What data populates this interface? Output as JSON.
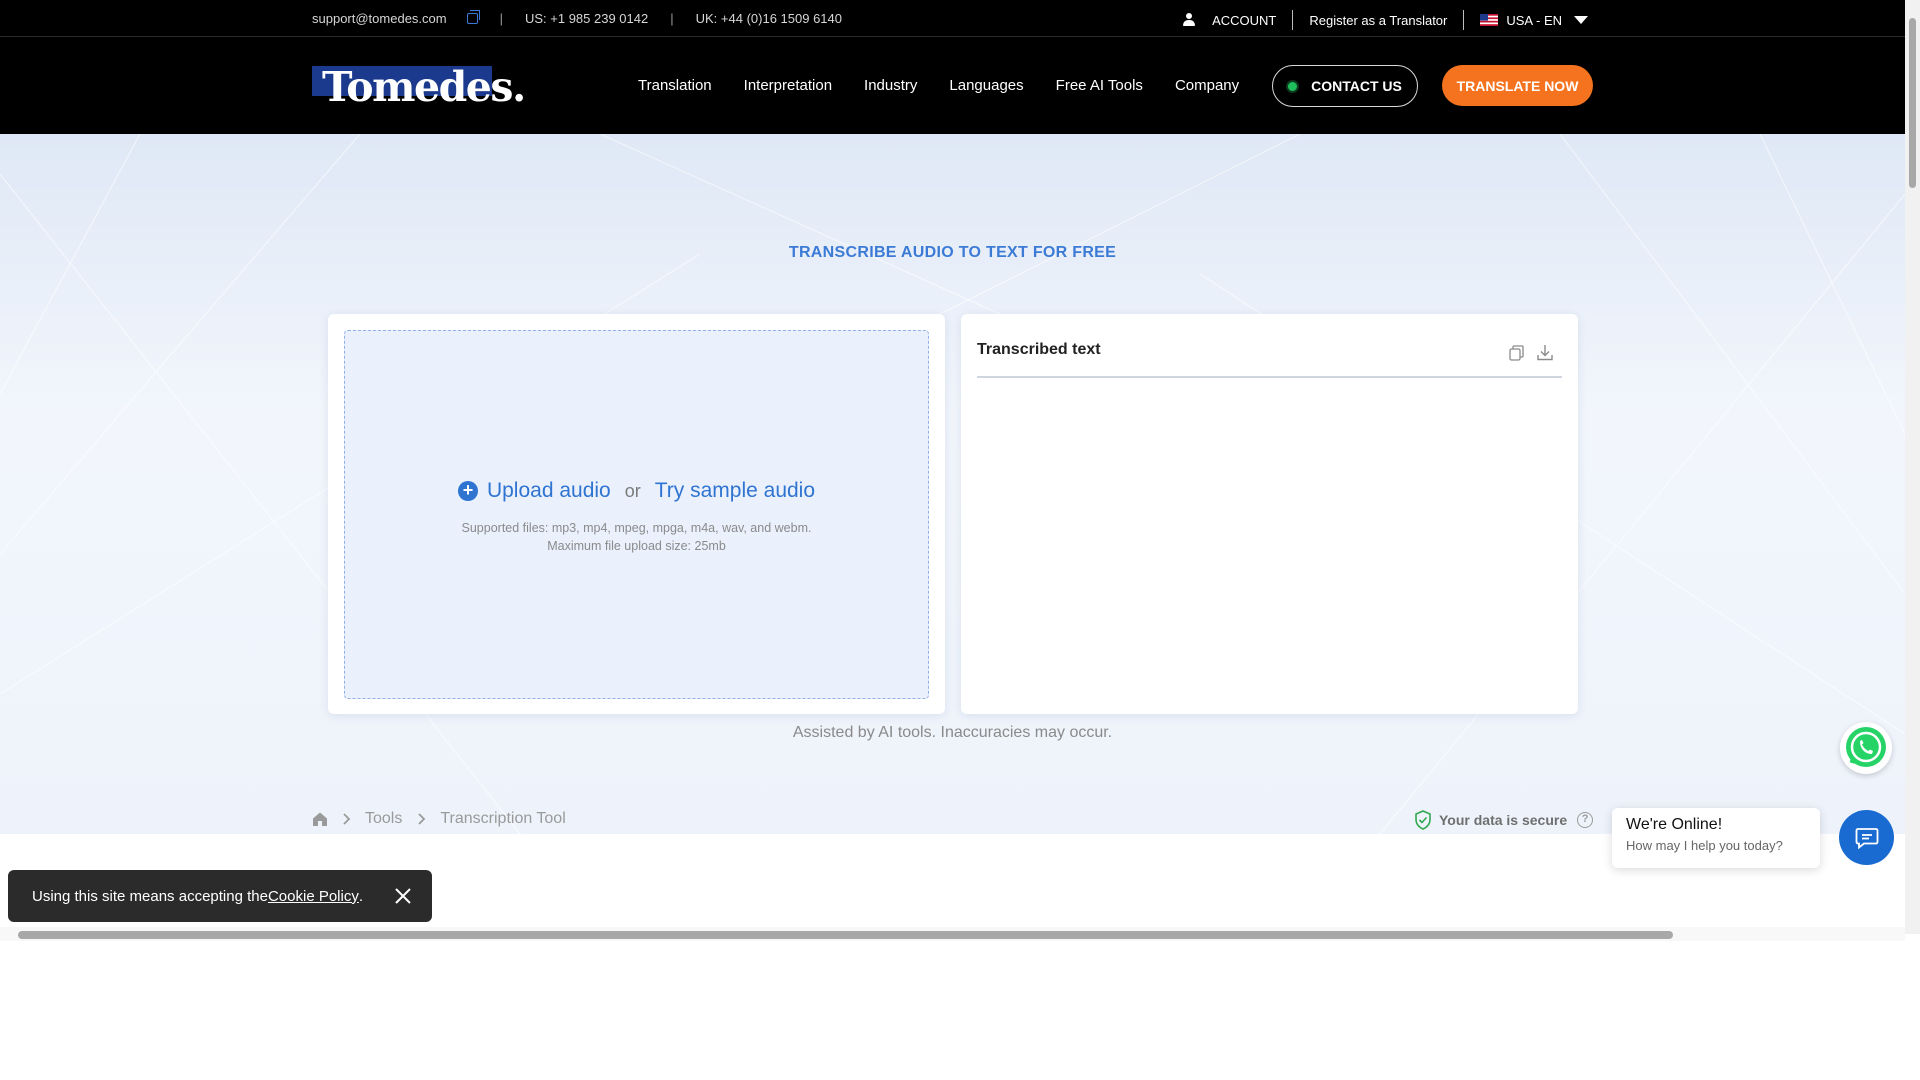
{
  "topbar": {
    "email": "support@tomedes.com",
    "us_phone": "US: +1 985 239 0142",
    "uk_phone": "UK: +44 (0)16 1509 6140",
    "account": "ACCOUNT",
    "register": "Register as a Translator",
    "locale": "USA - EN"
  },
  "nav": {
    "logo": "Tomedes.",
    "links": [
      "Translation",
      "Interpretation",
      "Industry",
      "Languages",
      "Free AI Tools",
      "Company"
    ],
    "contact": "CONTACT US",
    "translate": "TRANSLATE NOW"
  },
  "hero": {
    "title": "TRANSCRIBE AUDIO TO TEXT FOR FREE",
    "upload": "Upload audio",
    "or": "or",
    "sample": "Try sample audio",
    "supported": "Supported files: mp3, mp4, mpeg, mpga, m4a, wav, and webm.",
    "max_size": "Maximum file upload size: 25mb",
    "output_title": "Transcribed text",
    "disclaimer": "Assisted by AI tools. Inaccuracies may occur."
  },
  "breadcrumb": {
    "items": [
      "Tools",
      "Transcription Tool"
    ],
    "secure": "Your data is secure"
  },
  "chat": {
    "online": "We're Online!",
    "prompt": "How may I help you today?"
  },
  "cookie": {
    "text": "Using this site means accepting the ",
    "link": "Cookie Policy",
    "end": "."
  },
  "colors": {
    "accent_blue": "#3b7bd6",
    "cta_orange": "#f5731e",
    "chat_blue": "#1a6bd1"
  }
}
